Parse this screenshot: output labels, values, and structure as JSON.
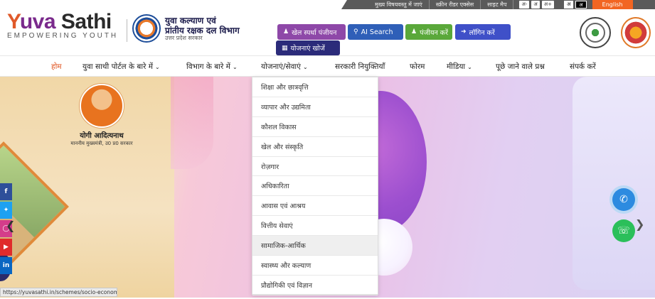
{
  "topbar": {
    "links": [
      "मुख्य विषयवस्तु में जाएं",
      "स्क्रीन रीडर एक्सेस",
      "साइट मैप"
    ],
    "font_sizes": [
      "अ-",
      "अ",
      "अ+"
    ],
    "contrast": [
      "अ",
      "अ"
    ],
    "language": "English"
  },
  "brand": {
    "y": "Y",
    "yuva": "uva ",
    "sathi": "Sathi",
    "tagline": "EMPOWERING YOUTH"
  },
  "department": {
    "title_line1": "युवा कल्याण एवं",
    "title_line2": "प्रांतीय रक्षक दल विभाग",
    "subtitle": "उत्तर प्रदेश सरकार"
  },
  "header_buttons": {
    "sports_registration": "खेल स्पर्धा पंजीयन",
    "ai_search": "AI Search",
    "registration": "पंजीयन करें",
    "login": "लॉगिन करें",
    "find_schemes": "योजनाएं खोजें"
  },
  "nav": {
    "items": [
      {
        "label": "होम",
        "caret": false
      },
      {
        "label": "युवा साथी पोर्टल के बारे में",
        "caret": true
      },
      {
        "label": "विभाग के बारे में",
        "caret": true
      },
      {
        "label": "योजनाएं/सेवाएं",
        "caret": true
      },
      {
        "label": "सरकारी नियुक्तियाँ",
        "caret": false
      },
      {
        "label": "फोरम",
        "caret": false
      },
      {
        "label": "मीडिया",
        "caret": true
      },
      {
        "label": "पूछे जाने वाले प्रश्न",
        "caret": false
      },
      {
        "label": "संपर्क करें",
        "caret": false
      }
    ],
    "caret_glyph": "⌄"
  },
  "hero": {
    "cm_name": "योगी आदित्यनाथ",
    "cm_title": "माननीय मुख्यमंत्री, उ0 प्र0 सरकार"
  },
  "schemes_menu": [
    "शिक्षा और छात्रवृत्ति",
    "व्यापार और उद्यमिता",
    "कौशल विकास",
    "खेल और संस्कृति",
    "रोज़गार",
    "अधिकारिता",
    "आवास एवं आश्रय",
    "वित्तीय सेवाएं",
    "सामाजिक-आर्थिक",
    "स्वास्थ्य और कल्याण",
    "प्रौद्योगिकी एवं विज्ञान"
  ],
  "status_url": "https://yuvasathi.in/schemes/socio-economic",
  "social": [
    "f",
    "t",
    "ig",
    "yt",
    "in"
  ],
  "colors": {
    "accent_orange": "#e0531f",
    "purple": "#8e48a8",
    "blue": "#2f5fb8",
    "green": "#5aa83a",
    "navy": "#2b2b7a"
  }
}
